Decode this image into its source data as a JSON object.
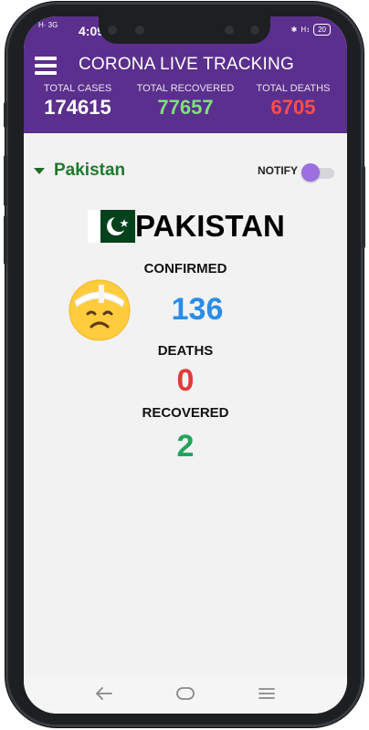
{
  "status_bar": {
    "network": "H·  3G",
    "time": "4:09",
    "battery": "20"
  },
  "header": {
    "title": "CORONA LIVE TRACKING",
    "stats": [
      {
        "label": "TOTAL CASES",
        "value": "174615",
        "color": "#ffffff"
      },
      {
        "label": "TOTAL RECOVERED",
        "value": "77657",
        "color": "#7ee07d"
      },
      {
        "label": "TOTAL DEATHS",
        "value": "6705",
        "color": "#ff4d4d"
      }
    ]
  },
  "country_selector": {
    "selected": "Pakistan",
    "notify_label": "NOTIFY",
    "notify_on": true
  },
  "country_card": {
    "name": "PAKISTAN",
    "confirmed_label": "CONFIRMED",
    "confirmed_value": "136",
    "deaths_label": "DEATHS",
    "deaths_value": "0",
    "recovered_label": "RECOVERED",
    "recovered_value": "2"
  },
  "colors": {
    "header_bg": "#5b2f8d",
    "confirmed": "#2b8ce6",
    "deaths": "#e23b3b",
    "recovered": "#22a45a",
    "country_green": "#1e7a2c",
    "toggle": "#9b6fe0"
  },
  "icons": {
    "menu": "hamburger-menu-icon",
    "emoji": "bandaged-face-emoji-icon",
    "nav_back": "back-arrow-icon",
    "nav_home": "home-icon",
    "nav_menu": "recents-menu-icon"
  }
}
